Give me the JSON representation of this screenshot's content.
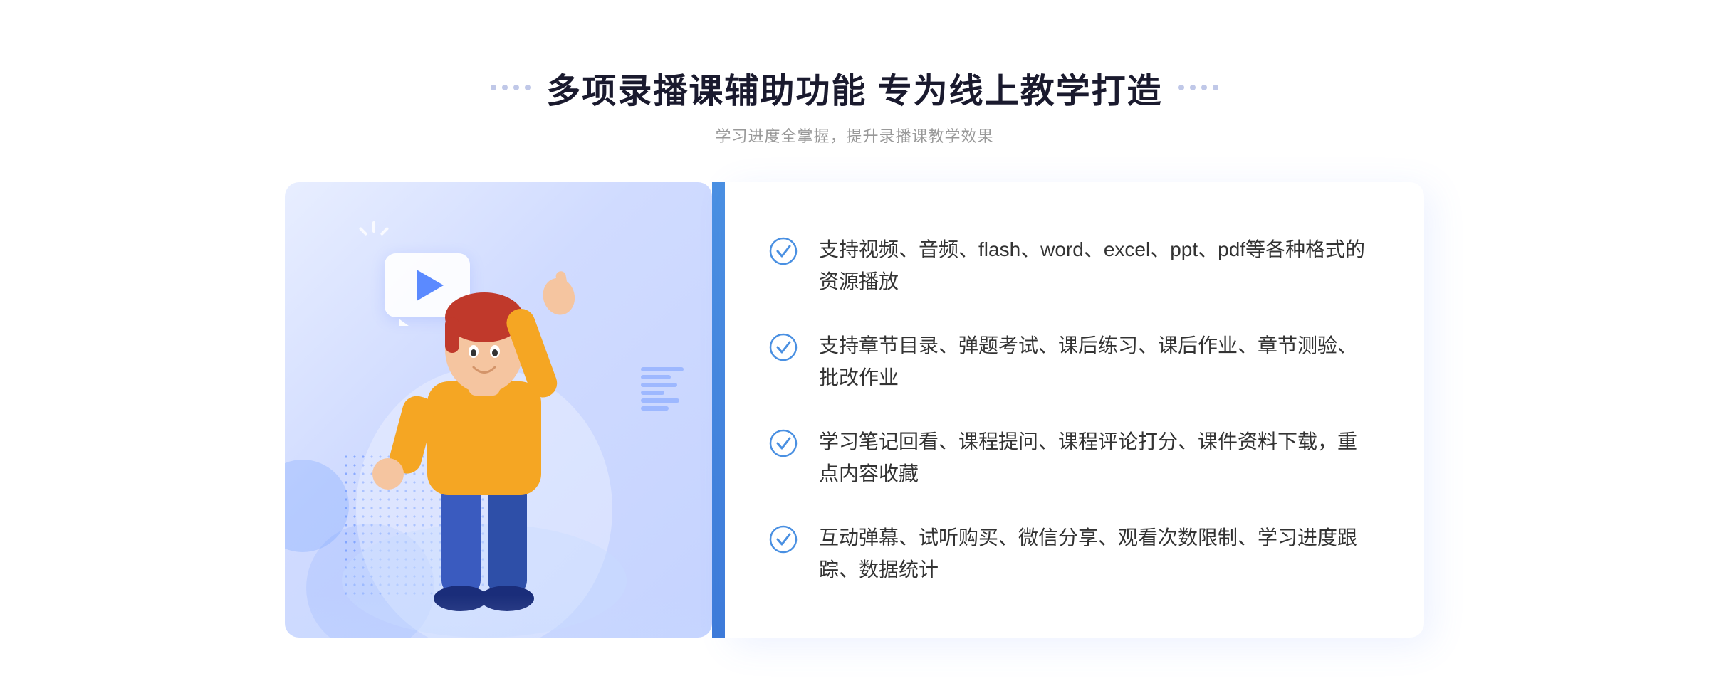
{
  "header": {
    "main_title": "多项录播课辅助功能 专为线上教学打造",
    "subtitle": "学习进度全掌握，提升录播课教学效果"
  },
  "features": [
    {
      "id": "feature-1",
      "text": "支持视频、音频、flash、word、excel、ppt、pdf等各种格式的资源播放"
    },
    {
      "id": "feature-2",
      "text": "支持章节目录、弹题考试、课后练习、课后作业、章节测验、批改作业"
    },
    {
      "id": "feature-3",
      "text": "学习笔记回看、课程提问、课程评论打分、课件资料下载，重点内容收藏"
    },
    {
      "id": "feature-4",
      "text": "互动弹幕、试听购买、微信分享、观看次数限制、学习进度跟踪、数据统计"
    }
  ],
  "colors": {
    "accent_blue": "#4a90e2",
    "light_blue": "#5b8aff",
    "text_dark": "#1a1a2e",
    "text_gray": "#999",
    "bg_gradient_start": "#e8eeff",
    "bg_gradient_end": "#c5d3ff"
  }
}
